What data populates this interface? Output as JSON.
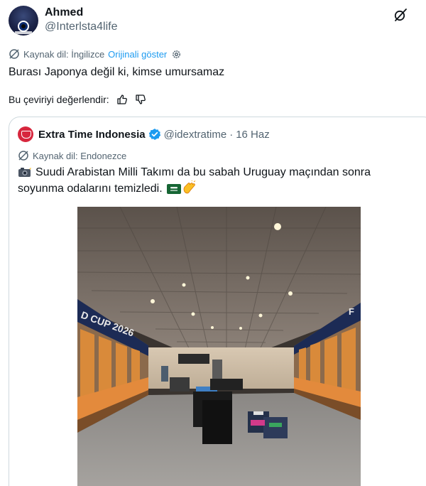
{
  "user": {
    "display_name": "Ahmed",
    "handle": "@Interlsta4life"
  },
  "translation": {
    "source_label": "Kaynak dil: İngilizce",
    "show_original": "Orijinali göster"
  },
  "tweet": {
    "text": "Burası Japonya değil ki, kimse umursamaz"
  },
  "rating": {
    "label": "Bu çeviriyi değerlendir:"
  },
  "quoted": {
    "display_name": "Extra Time Indonesia",
    "handle": "@idextratime",
    "separator": "·",
    "date": "16 Haz",
    "translation_label": "Kaynak dil: Endonezce",
    "text_line1": "Suudi Arabistan Milli Takımı da bu sabah Uruguay maçından sonra",
    "text_line2": "soyunma odalarını temizledi.",
    "photo_banner_text": "D CUP 2026",
    "photo_banner_text_right": "F"
  },
  "icons": {
    "grok": "grok-icon",
    "translate": "translate-icon",
    "settings": "gear-icon",
    "thumbs_up": "thumbs-up-icon",
    "thumbs_down": "thumbs-down-icon",
    "verified": "verified-badge-icon",
    "camera_emoji": "camera-flash-emoji",
    "flag_emoji": "saudi-flag-emoji",
    "clap_emoji": "clapping-hands-emoji"
  },
  "colors": {
    "link": "#1d9bf0",
    "secondary_text": "#536471",
    "primary_text": "#0f1419",
    "border": "#cfd9de",
    "verified": "#1d9bf0",
    "quoted_avatar": "#d7263d"
  }
}
